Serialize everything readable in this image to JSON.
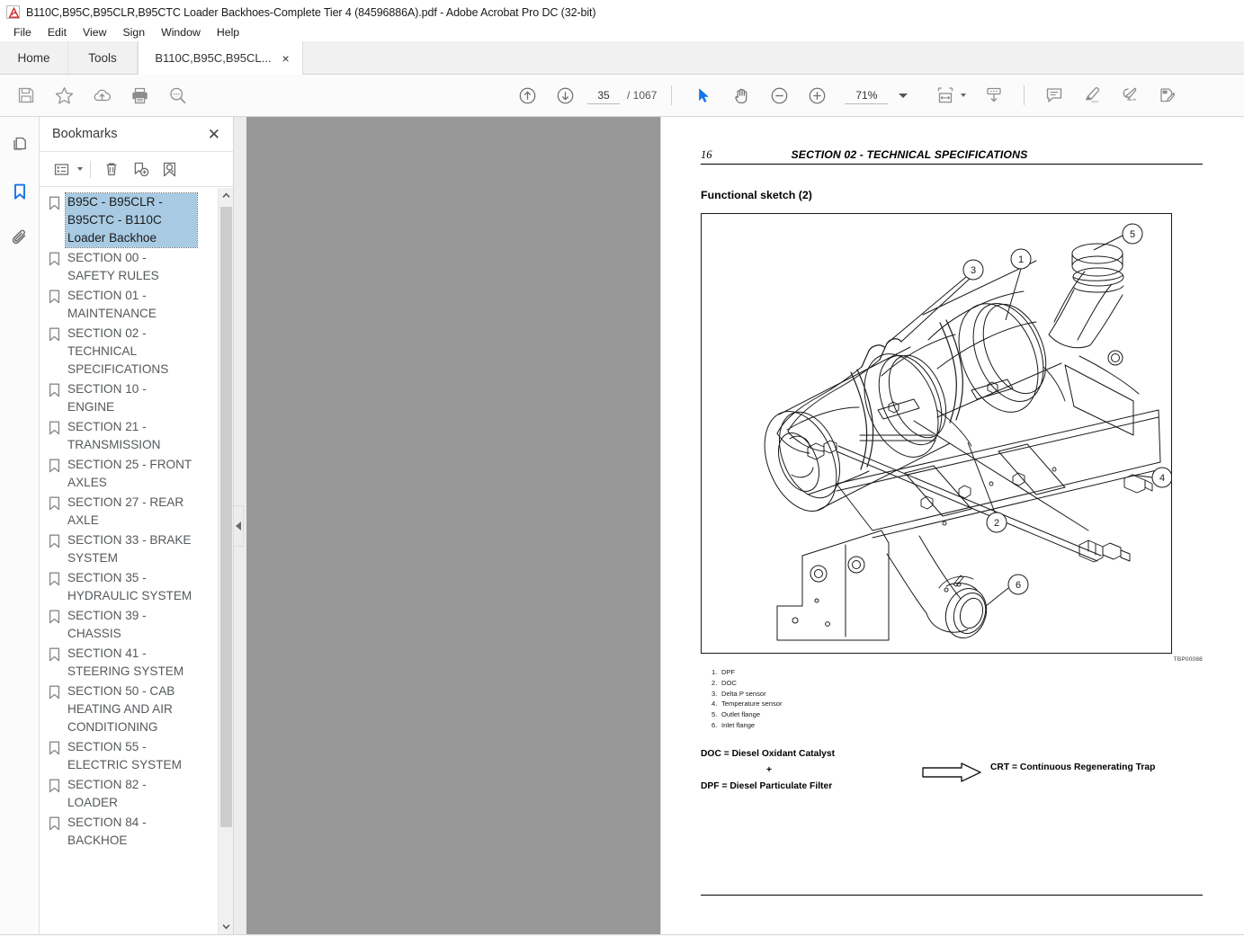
{
  "window": {
    "title": "B110C,B95C,B95CLR,B95CTC Loader Backhoes-Complete Tier 4 (84596886A).pdf - Adobe Acrobat Pro DC (32-bit)",
    "app_icon": "adobe-acrobat-icon"
  },
  "menubar": {
    "items": [
      {
        "label": "File"
      },
      {
        "label": "Edit"
      },
      {
        "label": "View"
      },
      {
        "label": "Sign"
      },
      {
        "label": "Window"
      },
      {
        "label": "Help"
      }
    ]
  },
  "tabs": {
    "home": "Home",
    "tools": "Tools",
    "document": "B110C,B95C,B95CL...",
    "close_glyph": "×"
  },
  "toolbar": {
    "left_icons": [
      {
        "name": "save-icon",
        "title": "Save file"
      },
      {
        "name": "star-icon",
        "title": "Add to favorites"
      },
      {
        "name": "cloud-upload-icon",
        "title": "Save to cloud"
      },
      {
        "name": "print-icon",
        "title": "Print file"
      },
      {
        "name": "search-icon",
        "title": "Find"
      }
    ],
    "prev_page_icon": "arrow-up-circle-icon",
    "next_page_icon": "arrow-down-circle-icon",
    "page_number": "35",
    "page_total": "/ 1067",
    "select_tool_icon": "cursor-arrow-icon",
    "hand_tool_icon": "hand-icon",
    "zoom_out_icon": "minus-circle-icon",
    "zoom_in_icon": "plus-circle-icon",
    "zoom_value": "71%",
    "zoom_caret": "chevron-down-icon",
    "fit_page_icon": "fit-page-icon",
    "scroll_mode_icon": "scroll-mode-icon",
    "right_icons": [
      {
        "name": "comment-icon",
        "title": "Add comment"
      },
      {
        "name": "highlight-icon",
        "title": "Highlight text"
      },
      {
        "name": "sign-icon",
        "title": "Fill & Sign"
      },
      {
        "name": "edit-pdf-icon",
        "title": "Edit PDF"
      }
    ]
  },
  "rail": {
    "items": [
      {
        "name": "page-thumbnails-icon",
        "label": "Page Thumbnails",
        "active": false
      },
      {
        "name": "bookmarks-icon",
        "label": "Bookmarks",
        "active": true
      },
      {
        "name": "attachments-icon",
        "label": "Attachments",
        "active": false
      }
    ]
  },
  "bookmarks_panel": {
    "title": "Bookmarks",
    "close_glyph": "✕",
    "toolbar": {
      "options_icon": "list-options-icon",
      "options_caret": "chevron-down-icon",
      "delete_icon": "trash-icon",
      "new_bookmark_icon": "new-bookmark-icon",
      "find_bookmark_icon": "locate-bookmark-icon"
    },
    "items": [
      {
        "label": "B95C - B95CLR - B95CTC - B110C Loader Backhoe",
        "selected": true
      },
      {
        "label": "SECTION 00 - SAFETY RULES",
        "selected": false
      },
      {
        "label": "SECTION 01 - MAINTENANCE",
        "selected": false
      },
      {
        "label": "SECTION 02 - TECHNICAL SPECIFICATIONS",
        "selected": false
      },
      {
        "label": "SECTION 10 - ENGINE",
        "selected": false
      },
      {
        "label": "SECTION 21 - TRANSMISSION",
        "selected": false
      },
      {
        "label": "SECTION 25 - FRONT AXLES",
        "selected": false
      },
      {
        "label": "SECTION 27 - REAR AXLE",
        "selected": false
      },
      {
        "label": "SECTION 33 - BRAKE SYSTEM",
        "selected": false
      },
      {
        "label": "SECTION 35 - HYDRAULIC SYSTEM",
        "selected": false
      },
      {
        "label": "SECTION 39 - CHASSIS",
        "selected": false
      },
      {
        "label": "SECTION 41 - STEERING SYSTEM",
        "selected": false
      },
      {
        "label": "SECTION 50 - CAB HEATING AND AIR CONDITIONING",
        "selected": false
      },
      {
        "label": "SECTION 55 - ELECTRIC SYSTEM",
        "selected": false
      },
      {
        "label": "SECTION 82 - LOADER",
        "selected": false
      },
      {
        "label": "SECTION 84 - BACKHOE",
        "selected": false
      }
    ],
    "scrollbar": {
      "up_arrow": "⌃",
      "down_arrow": "⌄"
    },
    "collapse_handle_icon": "triangle-left-icon"
  },
  "document_page": {
    "page_label": "16",
    "section_header": "SECTION 02 - TECHNICAL SPECIFICATIONS",
    "figure_title": "Functional sketch (2)",
    "figure_code": "TBP00088",
    "legend": [
      {
        "num": "1.",
        "text": "DPF"
      },
      {
        "num": "2.",
        "text": "DOC"
      },
      {
        "num": "3.",
        "text": "Delta P sensor"
      },
      {
        "num": "4.",
        "text": "Temperature sensor"
      },
      {
        "num": "5.",
        "text": "Outlet flange"
      },
      {
        "num": "6.",
        "text": "Inlet flange"
      }
    ],
    "equation": {
      "line1": "DOC = Diesel Oxidant Catalyst",
      "plus": "+",
      "line2": "DPF = Diesel Particulate Filter",
      "arrow_icon": "arrow-right-outline-icon",
      "result": "CRT = Continuous Regenerating Trap"
    },
    "callouts": [
      "1",
      "2",
      "3",
      "4",
      "5",
      "6"
    ]
  },
  "colors": {
    "accent": "#1473e6",
    "selection": "#a8cbe3",
    "chrome": "#fbfbfb",
    "doc_gray": "#989898"
  }
}
